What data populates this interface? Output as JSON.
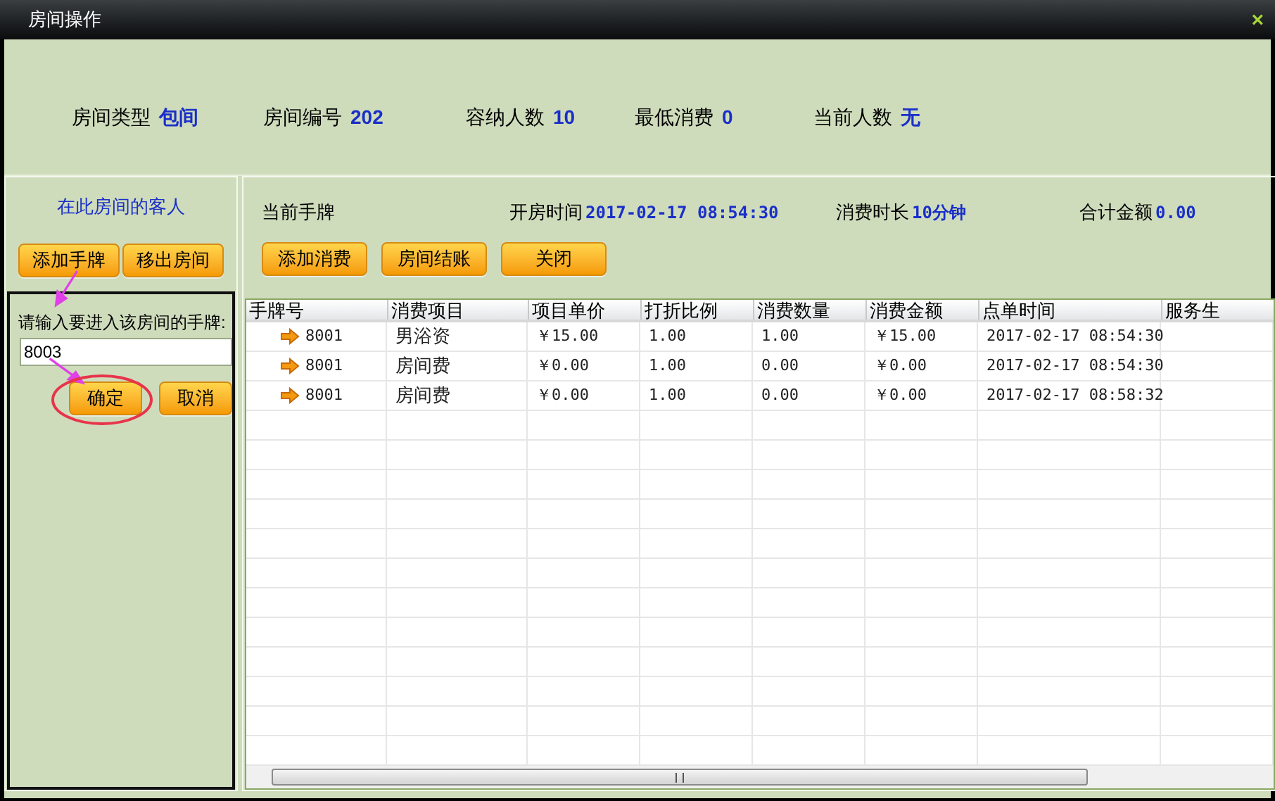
{
  "window": {
    "title": "房间操作",
    "close": "×"
  },
  "room_info": [
    {
      "label": "房间类型",
      "value": "包间"
    },
    {
      "label": "房间编号",
      "value": "202"
    },
    {
      "label": "容纳人数",
      "value": "10"
    },
    {
      "label": "最低消费",
      "value": "0"
    },
    {
      "label": "当前人数",
      "value": "无"
    }
  ],
  "guests_panel": {
    "title": "在此房间的客人",
    "buttons": [
      "添加手牌",
      "移出房间"
    ],
    "prompt": "请输入要进入该房间的手牌:",
    "input_value": "8003",
    "confirm_buttons": [
      "确定",
      "取消"
    ]
  },
  "current_tag": {
    "label": "当前手牌",
    "stats": [
      {
        "label": "开房时间",
        "value": "2017-02-17 08:54:30"
      },
      {
        "label": "消费时长",
        "value": "10分钟"
      },
      {
        "label": "合计金额",
        "value": "0.00"
      }
    ],
    "buttons": [
      "添加消费",
      "房间结账",
      "关闭"
    ]
  },
  "table": {
    "columns": [
      "手牌号",
      "消费项目",
      "项目单价",
      "打折比例",
      "消费数量",
      "消费金额",
      "点单时间",
      "服务生"
    ],
    "rows": [
      [
        "8001",
        "男浴资",
        "￥15.00",
        "1.00",
        "1.00",
        "￥15.00",
        "2017-02-17 08:54:30",
        ""
      ],
      [
        "8001",
        "房间费",
        "￥0.00",
        "1.00",
        "0.00",
        "￥0.00",
        "2017-02-17 08:54:30",
        ""
      ],
      [
        "8001",
        "房间费",
        "￥0.00",
        "1.00",
        "0.00",
        "￥0.00",
        "2017-02-17 08:58:32",
        ""
      ]
    ]
  }
}
